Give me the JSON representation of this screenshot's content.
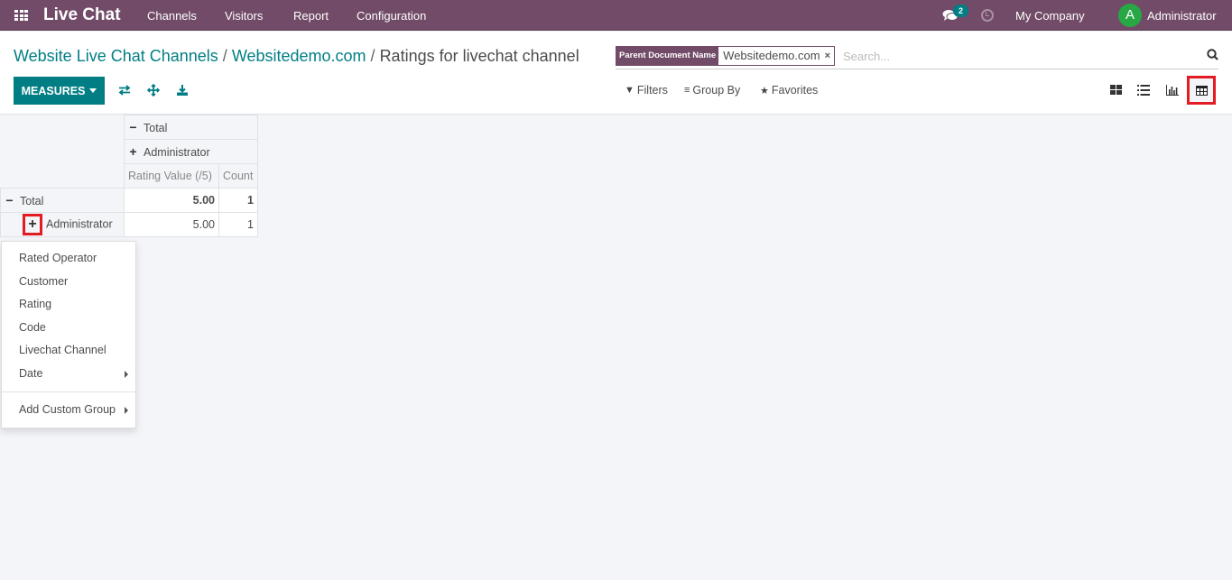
{
  "navbar": {
    "app_title": "Live Chat",
    "menu": [
      "Channels",
      "Visitors",
      "Report",
      "Configuration"
    ],
    "messages_badge": "2",
    "company": "My Company",
    "user_initial": "A",
    "user_name": "Administrator",
    "colors": {
      "navbar_bg": "#714b67",
      "badge_bg": "#017e84",
      "avatar_bg": "#28a745"
    }
  },
  "breadcrumb": {
    "items": [
      "Website Live Chat Channels",
      "Websitedemo.com"
    ],
    "current": "Ratings for livechat channel",
    "separator": "/"
  },
  "search": {
    "facet_label": "Parent Document Name",
    "facet_value": "Websitedemo.com",
    "facet_close": "×",
    "placeholder": "Search..."
  },
  "toolbar": {
    "measures_label": "MEASURES",
    "icons": [
      "flip-axis-icon",
      "expand-all-icon",
      "download-icon"
    ],
    "accent_color": "#017e84"
  },
  "filters": {
    "filters_label": "Filters",
    "group_by_label": "Group By",
    "favorites_label": "Favorites"
  },
  "views": {
    "items": [
      "kanban",
      "list",
      "graph",
      "pivot"
    ],
    "active": "pivot"
  },
  "pivot": {
    "col_header_total": "Total",
    "col_header_group": "Administrator",
    "measures": [
      "Rating Value (/5)",
      "Count"
    ],
    "rows": [
      {
        "label": "Total",
        "expanded": true,
        "values": [
          "5.00",
          "1"
        ],
        "bold": true
      },
      {
        "label": "Administrator",
        "expanded": false,
        "values": [
          "5.00",
          "1"
        ],
        "bold": false
      }
    ]
  },
  "groupby_dropdown": {
    "items": [
      "Rated Operator",
      "Customer",
      "Rating",
      "Code",
      "Livechat Channel",
      "Date"
    ],
    "custom_group_label": "Add Custom Group"
  },
  "highlight_color": "#e31b23"
}
